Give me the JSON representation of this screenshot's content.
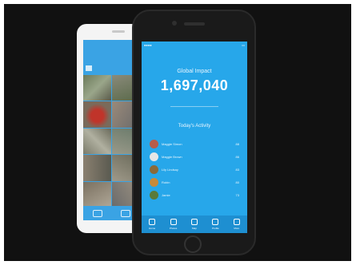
{
  "screen": {
    "impact_title": "Global Impact",
    "impact_value": "1,697,040",
    "activity_title": "Today's Activity"
  },
  "activity": [
    {
      "name": "Maggie Simon",
      "score": "88",
      "avatar_color": "#b85c4a"
    },
    {
      "name": "Maggie Brown",
      "score": "86",
      "avatar_color": "#e6e6e6"
    },
    {
      "name": "Lily Lindsay",
      "score": "83",
      "avatar_color": "#8a6a3a"
    },
    {
      "name": "Robin",
      "score": "80",
      "avatar_color": "#c88a3a"
    },
    {
      "name": "Jamie",
      "score": "73",
      "avatar_color": "#5a7a3a"
    }
  ],
  "tabs": [
    {
      "label": "Home"
    },
    {
      "label": "Photos"
    },
    {
      "label": "Map"
    },
    {
      "label": "Profile"
    },
    {
      "label": "More"
    }
  ],
  "colors": {
    "screen_blue": "#27a7ea",
    "tabbar_blue": "#1e8fd1",
    "background": "#111111"
  }
}
